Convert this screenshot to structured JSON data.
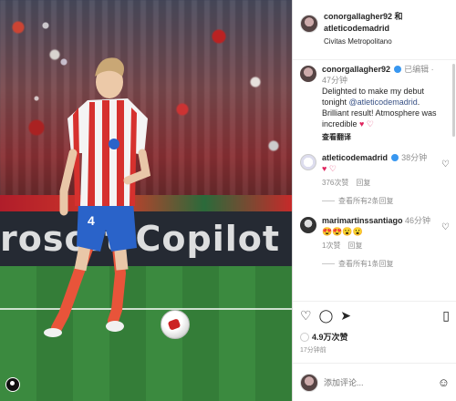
{
  "post": {
    "author_line": "conorgallagher92 和",
    "coauthor": "atleticodemadrid",
    "location": "Civitas Metropolitano"
  },
  "photo": {
    "hoarding_text": "rosoft Copilot"
  },
  "comments": [
    {
      "user": "conorgallagher92",
      "badge": "已编辑",
      "time": "47分钟",
      "text_before": "Delighted to make my debut tonight ",
      "mention": "@atleticodemadrid",
      "text_after": ". Brilliant result! Atmosphere was incredible",
      "hearts": "♥ ♡",
      "translate": "查看翻译"
    },
    {
      "user": "atleticodemadrid",
      "time": "38分钟",
      "text": "♥ ♡",
      "likes": "376次赞",
      "reply": "回复",
      "replies": "查看所有2条回复"
    },
    {
      "user": "marimartinssantiago",
      "time": "46分钟",
      "text": "😍😍😮😮",
      "likes": "1次赞",
      "reply": "回复",
      "replies": "查看所有1条回复"
    }
  ],
  "actions": {
    "likes": "4.9万次赞",
    "date": "17分钟前"
  },
  "composer": {
    "placeholder": "添加评论..."
  },
  "icons": {
    "like": "heart-icon",
    "comment": "comment-icon",
    "share": "share-icon",
    "save": "bookmark-icon",
    "emoji": "emoji-icon"
  }
}
